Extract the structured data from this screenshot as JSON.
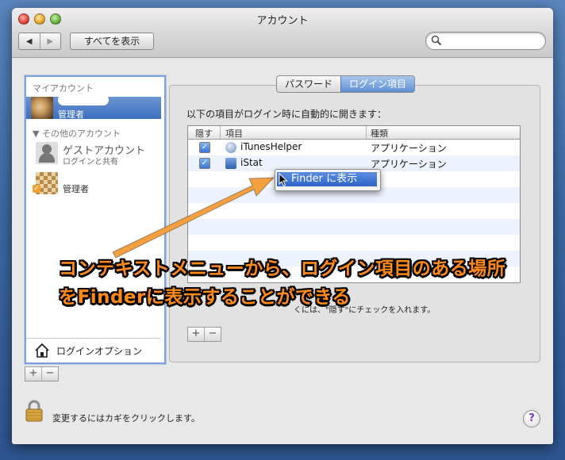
{
  "window": {
    "title": "アカウント"
  },
  "toolbar": {
    "back": "◀",
    "forward": "▶",
    "show_all": "すべてを表示",
    "search_placeholder": ""
  },
  "sidebar": {
    "my_account_header": "マイアカウント",
    "current_user_label": "管理者",
    "other_accounts_header": "▼ その他のアカウント",
    "guest_name": "ゲストアカウント",
    "guest_sub": "ログインと共有",
    "admin2_label": "管理者",
    "login_options": "ログインオプション",
    "plus": "+",
    "minus": "−"
  },
  "tabs": [
    {
      "label": "パスワード",
      "active": false
    },
    {
      "label": "ログイン項目",
      "active": true
    }
  ],
  "login_items": {
    "intro": "以下の項目がログイン時に自動的に開きます：",
    "columns": [
      "隠す",
      "項目",
      "種類"
    ],
    "rows": [
      {
        "checked": true,
        "name": "iTunesHelper",
        "type": "アプリケーション"
      },
      {
        "checked": true,
        "name": "iStat",
        "type": "アプリケーション"
      }
    ],
    "hint_visible": "くには、\"隠す\"にチェックを入れます。",
    "plus": "+",
    "minus": "−"
  },
  "context_menu": {
    "item": "Finder に表示"
  },
  "annotation": {
    "line1": "コンテキストメニューから、ログイン項目のある場所",
    "line2": "をFinderに表示することができる",
    "color": "#ff8a1c"
  },
  "footer": {
    "lock_text": "変更するにはカギをクリックします。",
    "help": "?"
  }
}
